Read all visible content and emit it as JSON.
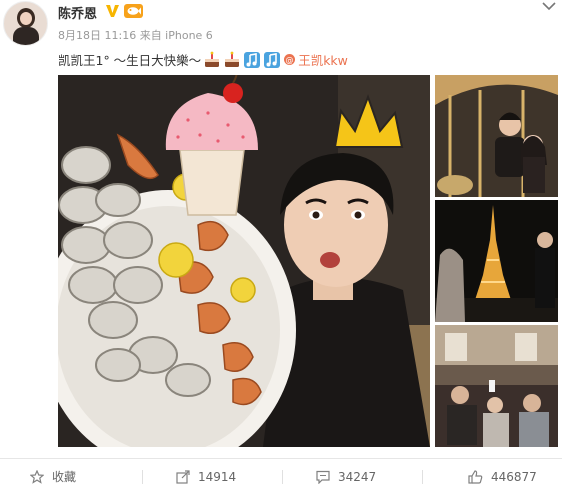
{
  "post": {
    "username": "陈乔恩",
    "vip_label": "🐠",
    "meta": "8月18日 11:16 来自 iPhone 6",
    "text": "凯凯王1° ～生日大快樂～",
    "mention": "王凯kkw"
  },
  "actions": {
    "favorite_label": "收藏",
    "forward_count": "14914",
    "comment_count": "34247",
    "like_count": "446877"
  },
  "colors": {
    "accent": "#eb7350",
    "vip": "#f7a21b",
    "verified": "#f7b500"
  },
  "icons": [
    "chevron-down-icon",
    "verified-icon",
    "vip-icon",
    "cake-emoji-icon",
    "music-note-emoji-icon",
    "link-icon",
    "star-icon",
    "forward-icon",
    "comment-icon",
    "thumbs-up-icon"
  ]
}
